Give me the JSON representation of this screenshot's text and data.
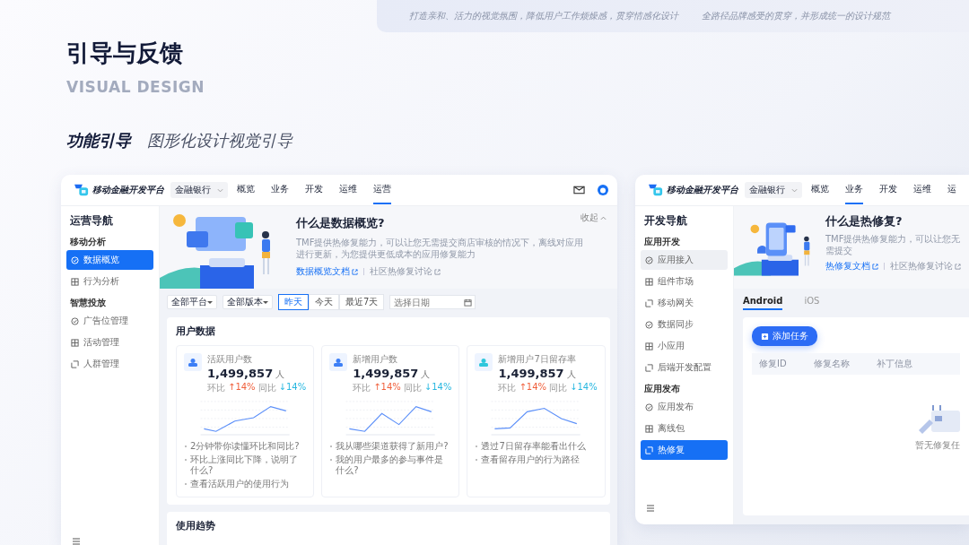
{
  "header": {
    "taglines": [
      "打造亲和、活力的视觉氛围，降低用户工作烦燥感，贯穿情感化设计",
      "全路径品牌感受的贯穿，并形成统一的设计规范"
    ],
    "title": "引导与反馈",
    "subtitle": "VISUAL DESIGN",
    "section_title": "功能引导",
    "section_subtitle": "图形化设计视觉引导"
  },
  "screens": [
    {
      "kind": "dashboard",
      "brand": "移动金融开发平台",
      "org_select": "金融银行",
      "account_icons": true,
      "nav": [
        {
          "label": "概览",
          "selected": false
        },
        {
          "label": "业务",
          "selected": false
        },
        {
          "label": "开发",
          "selected": false
        },
        {
          "label": "运维",
          "selected": false
        },
        {
          "label": "运营",
          "selected": true
        }
      ],
      "sidebar": {
        "title": "运营导航",
        "groups": [
          {
            "label": "移动分析",
            "items": [
              {
                "label": "数据概览",
                "selected": true,
                "hovered": false
              },
              {
                "label": "行为分析",
                "selected": false,
                "hovered": false
              }
            ]
          },
          {
            "label": "智慧投放",
            "items": [
              {
                "label": "广告位管理",
                "selected": false,
                "hovered": false
              },
              {
                "label": "活动管理",
                "selected": false,
                "hovered": false
              },
              {
                "label": "人群管理",
                "selected": false,
                "hovered": false
              }
            ]
          }
        ]
      },
      "banner": {
        "title": "什么是数据概览?",
        "description": "TMF提供热修复能力，可以让您无需提交商店审核的情况下，离线对应用进行更新，为您提供更低成本的应用修复能力",
        "links": [
          {
            "label": "数据概览文档",
            "kind": "primary"
          },
          {
            "label": "社区热修复讨论",
            "kind": "secondary"
          }
        ],
        "collapse": "收起"
      },
      "filters": {
        "selects": [
          "全部平台",
          "全部版本"
        ],
        "ranges": [
          {
            "label": "昨天",
            "selected": true
          },
          {
            "label": "今天",
            "selected": false
          },
          {
            "label": "最近7天",
            "selected": false
          }
        ],
        "date_placeholder": "选择日期"
      },
      "user_data": {
        "title": "用户数据",
        "stats": [
          {
            "label": "活跃用户数",
            "value": "1,499,857",
            "unit": "人",
            "mom_label": "环比",
            "mom": "↑14%",
            "yoy_label": "同比",
            "yoy": "↓14%",
            "color": "#3d7ff6",
            "questions": [
              "2分钟带你读懂环比和同比?",
              "环比上涨同比下降，说明了什么?",
              "查看活跃用户的使用行为"
            ]
          },
          {
            "label": "新增用户数",
            "value": "1,499,857",
            "unit": "人",
            "mom_label": "环比",
            "mom": "↑14%",
            "yoy_label": "同比",
            "yoy": "↓14%",
            "color": "#3d7ff6",
            "questions": [
              "我从哪些渠道获得了新用户?",
              "我的用户最多的参与事件是什么?"
            ]
          },
          {
            "label": "新增用户7日留存率",
            "value": "1,499,857",
            "unit": "人",
            "mom_label": "环比",
            "mom": "↑14%",
            "yoy_label": "同比",
            "yoy": "↓14%",
            "color": "#2fc7dc",
            "questions": [
              "透过7日留存率能看出什么",
              "查看留存用户的行为路径"
            ]
          }
        ]
      },
      "trend_title": "使用趋势"
    },
    {
      "kind": "hotfix",
      "brand": "移动金融开发平台",
      "org_select": "金融银行",
      "account_icons": false,
      "nav": [
        {
          "label": "概览",
          "selected": false
        },
        {
          "label": "业务",
          "selected": true
        },
        {
          "label": "开发",
          "selected": false
        },
        {
          "label": "运维",
          "selected": false
        },
        {
          "label": "运",
          "selected": false
        }
      ],
      "sidebar": {
        "title": "开发导航",
        "groups": [
          {
            "label": "应用开发",
            "items": [
              {
                "label": "应用接入",
                "selected": false,
                "hovered": true
              },
              {
                "label": "组件市场",
                "selected": false,
                "hovered": false
              },
              {
                "label": "移动网关",
                "selected": false,
                "hovered": false
              },
              {
                "label": "数据同步",
                "selected": false,
                "hovered": false
              },
              {
                "label": "小应用",
                "selected": false,
                "hovered": false
              },
              {
                "label": "后端开发配置",
                "selected": false,
                "hovered": false
              }
            ]
          },
          {
            "label": "应用发布",
            "items": [
              {
                "label": "应用发布",
                "selected": false,
                "hovered": false
              },
              {
                "label": "离线包",
                "selected": false,
                "hovered": false
              },
              {
                "label": "热修复",
                "selected": true,
                "hovered": false
              }
            ]
          }
        ]
      },
      "banner": {
        "title": "什么是热修复?",
        "description": "TMF提供热修复能力，可以让您无需提交",
        "links": [
          {
            "label": "热修复文档",
            "kind": "primary"
          },
          {
            "label": "社区热修复讨论",
            "kind": "secondary"
          }
        ]
      },
      "tabs": [
        {
          "label": "Android",
          "selected": true
        },
        {
          "label": "iOS",
          "selected": false
        }
      ],
      "add_button": "添加任务",
      "columns": [
        "修复ID",
        "修复名称",
        "补丁信息"
      ],
      "empty_text": "暂无修复任"
    }
  ]
}
